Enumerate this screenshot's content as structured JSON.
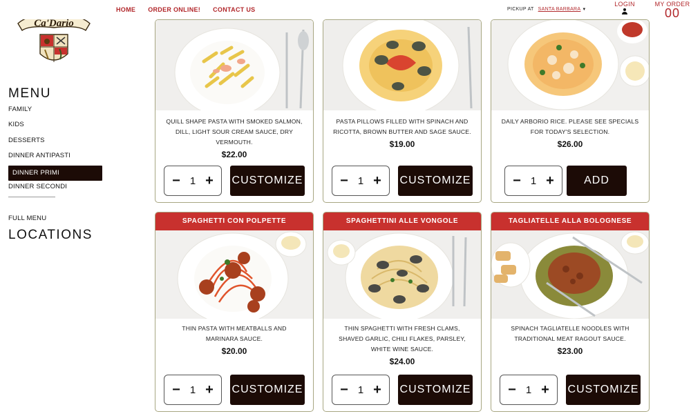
{
  "nav": {
    "links": [
      "HOME",
      "ORDER ONLINE!",
      "CONTACT US"
    ],
    "pickup_label": "PICKUP AT",
    "pickup_location": "SANTA BARBARA",
    "login_label": "LOGIN",
    "my_order_label": "MY ORDER",
    "order_count": "00"
  },
  "logo": {
    "text": "Ca'Dario"
  },
  "sidebar": {
    "menu_title": "MENU",
    "items": [
      "FAMILY",
      "KIDS",
      "DESSERTS",
      "DINNER ANTIPASTI",
      "DINNER PRIMI",
      "DINNER SECONDI"
    ],
    "active_item": "DINNER PRIMI",
    "full_menu": "FULL MENU",
    "locations_title": "LOCATIONS"
  },
  "cards": [
    {
      "title": "",
      "description": "QUILL SHAPE PASTA WITH SMOKED SALMON, DILL, LIGHT SOUR CREAM SAUCE, DRY VERMOUTH.",
      "price": "$22.00",
      "qty": "1",
      "button": "CUSTOMIZE"
    },
    {
      "title": "",
      "description": "PASTA PILLOWS FILLED WITH SPINACH AND RICOTTA, BROWN BUTTER AND SAGE SAUCE.",
      "price": "$19.00",
      "qty": "1",
      "button": "CUSTOMIZE"
    },
    {
      "title": "",
      "description": "DAILY ARBORIO RICE. PLEASE SEE SPECIALS FOR TODAY'S SELECTION.",
      "price": "$26.00",
      "qty": "1",
      "button": "ADD"
    },
    {
      "title": "SPAGHETTI CON POLPETTE",
      "description": "THIN PASTA WITH MEATBALLS AND MARINARA SAUCE.",
      "price": "$20.00",
      "qty": "1",
      "button": "CUSTOMIZE"
    },
    {
      "title": "SPAGHETTINI ALLE VONGOLE",
      "description": "THIN SPAGHETTI WITH FRESH CLAMS, SHAVED GARLIC, CHILI FLAKES, PARSLEY, WHITE WINE SAUCE.",
      "price": "$24.00",
      "qty": "1",
      "button": "CUSTOMIZE"
    },
    {
      "title": "TAGLIATELLE ALLA BOLOGNESE",
      "description": "SPINACH TAGLIATELLE NOODLES WITH TRADITIONAL MEAT RAGOUT SAUCE.",
      "price": "$23.00",
      "qty": "1",
      "button": "CUSTOMIZE"
    }
  ],
  "icons": {
    "minus": "minus-icon",
    "plus": "plus-icon",
    "user": "user-icon",
    "caret": "caret-down-icon"
  },
  "colors": {
    "accent": "#b1262a",
    "header_red": "#c8312e",
    "button_dark": "#1c0b06",
    "card_border": "#a7a681"
  }
}
